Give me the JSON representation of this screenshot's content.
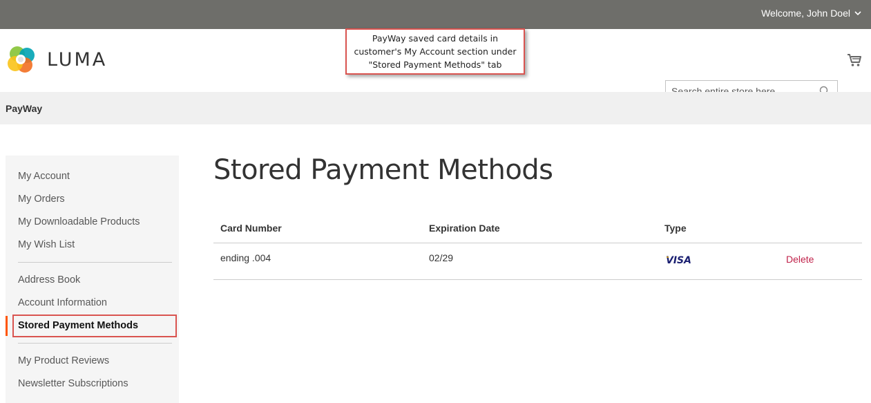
{
  "topbar": {
    "welcome": "Welcome, John Doel"
  },
  "header": {
    "logo_text": "LUMA",
    "search_placeholder": "Search entire store here...",
    "callout_lines": [
      "PayWay saved card details in",
      "customer's My Account section under",
      "\"Stored Payment Methods\" tab"
    ]
  },
  "breadcrumb": {
    "label": "PayWay"
  },
  "sidebar": {
    "items": [
      {
        "label": "My Account"
      },
      {
        "label": "My Orders"
      },
      {
        "label": "My Downloadable Products"
      },
      {
        "label": "My Wish List"
      },
      {
        "label": "Address Book"
      },
      {
        "label": "Account Information"
      },
      {
        "label": "Stored Payment Methods"
      },
      {
        "label": "My Product Reviews"
      },
      {
        "label": "Newsletter Subscriptions"
      }
    ],
    "active_color": "#ff5501"
  },
  "main": {
    "title": "Stored Payment Methods",
    "columns": [
      "Card Number",
      "Expiration Date",
      "Type"
    ],
    "rows": [
      {
        "card_number": "ending .004",
        "expiration": "02/29",
        "type": "VISA",
        "action": "Delete"
      }
    ]
  },
  "colors": {
    "topbar": "#6e6e6a",
    "link": "#c0224a",
    "callout_border": "#d9534f",
    "visa_blue": "#1a1f71",
    "visa_gold": "#f7b600"
  }
}
